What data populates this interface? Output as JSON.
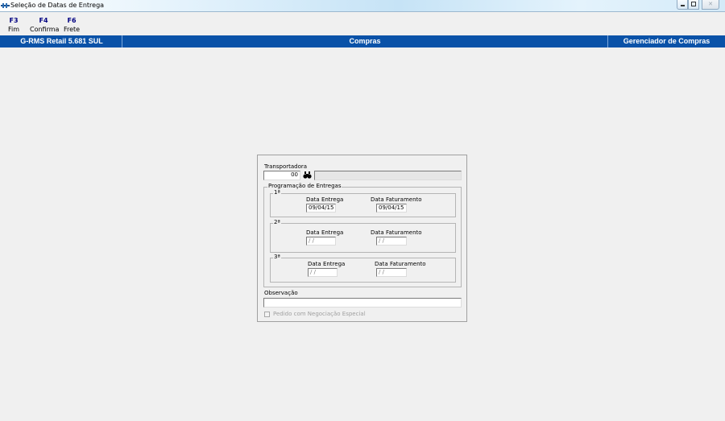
{
  "window": {
    "title": "Seleção de Datas de Entrega",
    "buttons": {
      "minimize": "minimize-icon",
      "maximize": "maximize-icon",
      "close": "close-icon"
    }
  },
  "toolbar": {
    "fkeys": [
      {
        "key": "F3",
        "label": "Fim"
      },
      {
        "key": "F4",
        "label": "Confirma"
      },
      {
        "key": "F6",
        "label": "Frete"
      }
    ]
  },
  "statusbar": {
    "left": "G-RMS Retail 5.681 SUL",
    "center": "Compras",
    "right": "Gerenciador de Compras",
    "color": "#0a52a8"
  },
  "form": {
    "transportadora_label": "Transportadora",
    "transportadora_code": "00",
    "transportadora_name": "",
    "search_icon": "binoculars-icon",
    "programacao_label": "Programação de Entregas",
    "deliveries": [
      {
        "title": "1ª",
        "entrega_label": "Data Entrega",
        "entrega_value": "09/04/15",
        "faturamento_label": "Data Faturamento",
        "faturamento_value": "09/04/15"
      },
      {
        "title": "2ª",
        "entrega_label": "Data Entrega",
        "entrega_value": " / /",
        "faturamento_label": "Data Faturamento",
        "faturamento_value": " / /"
      },
      {
        "title": "3ª",
        "entrega_label": "Data Entrega",
        "entrega_value": " / /",
        "faturamento_label": "Data Faturamento",
        "faturamento_value": " / /"
      }
    ],
    "observacao_label": "Observação",
    "observacao_value": "",
    "negociacao_label": "Pedido com Negociação Especial",
    "negociacao_checked": false
  }
}
